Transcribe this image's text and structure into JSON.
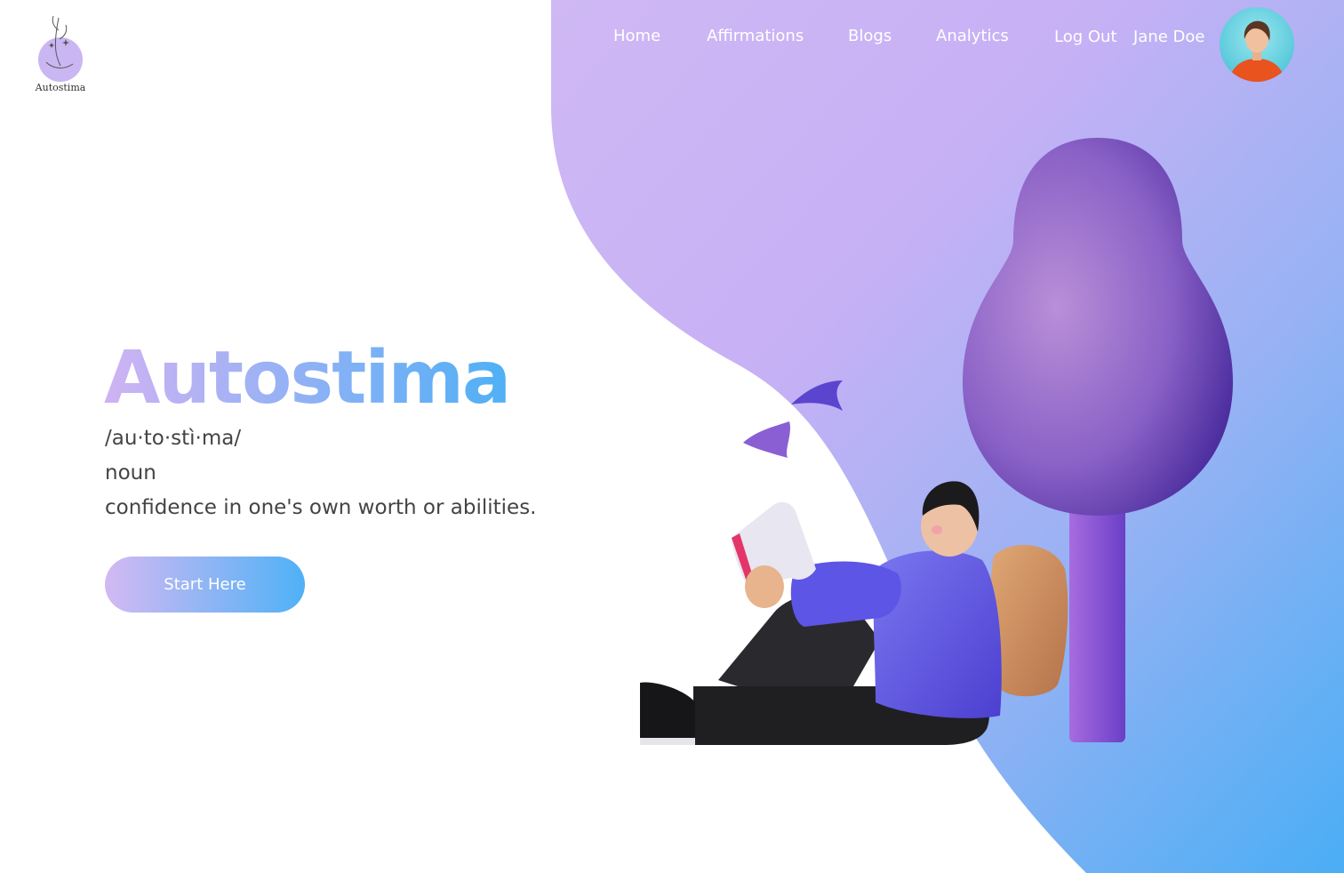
{
  "brand": {
    "logo_text": "Autostima"
  },
  "nav": {
    "home": "Home",
    "affirmations": "Affirmations",
    "blogs": "Blogs",
    "analytics": "Analytics",
    "logout": "Log Out",
    "user_name": "Jane Doe"
  },
  "hero": {
    "title": "Autostima",
    "pronunciation": "/au·to·stì·ma/",
    "part_of_speech": "noun",
    "definition": "confidence in one's own worth or abilities.",
    "cta_label": "Start Here"
  },
  "colors": {
    "gradient_start": "#cbb4f4",
    "gradient_end": "#4aaef5",
    "text": "#444444"
  },
  "icons": {
    "avatar": "user-avatar",
    "illustration": "person-reading-under-tree"
  }
}
